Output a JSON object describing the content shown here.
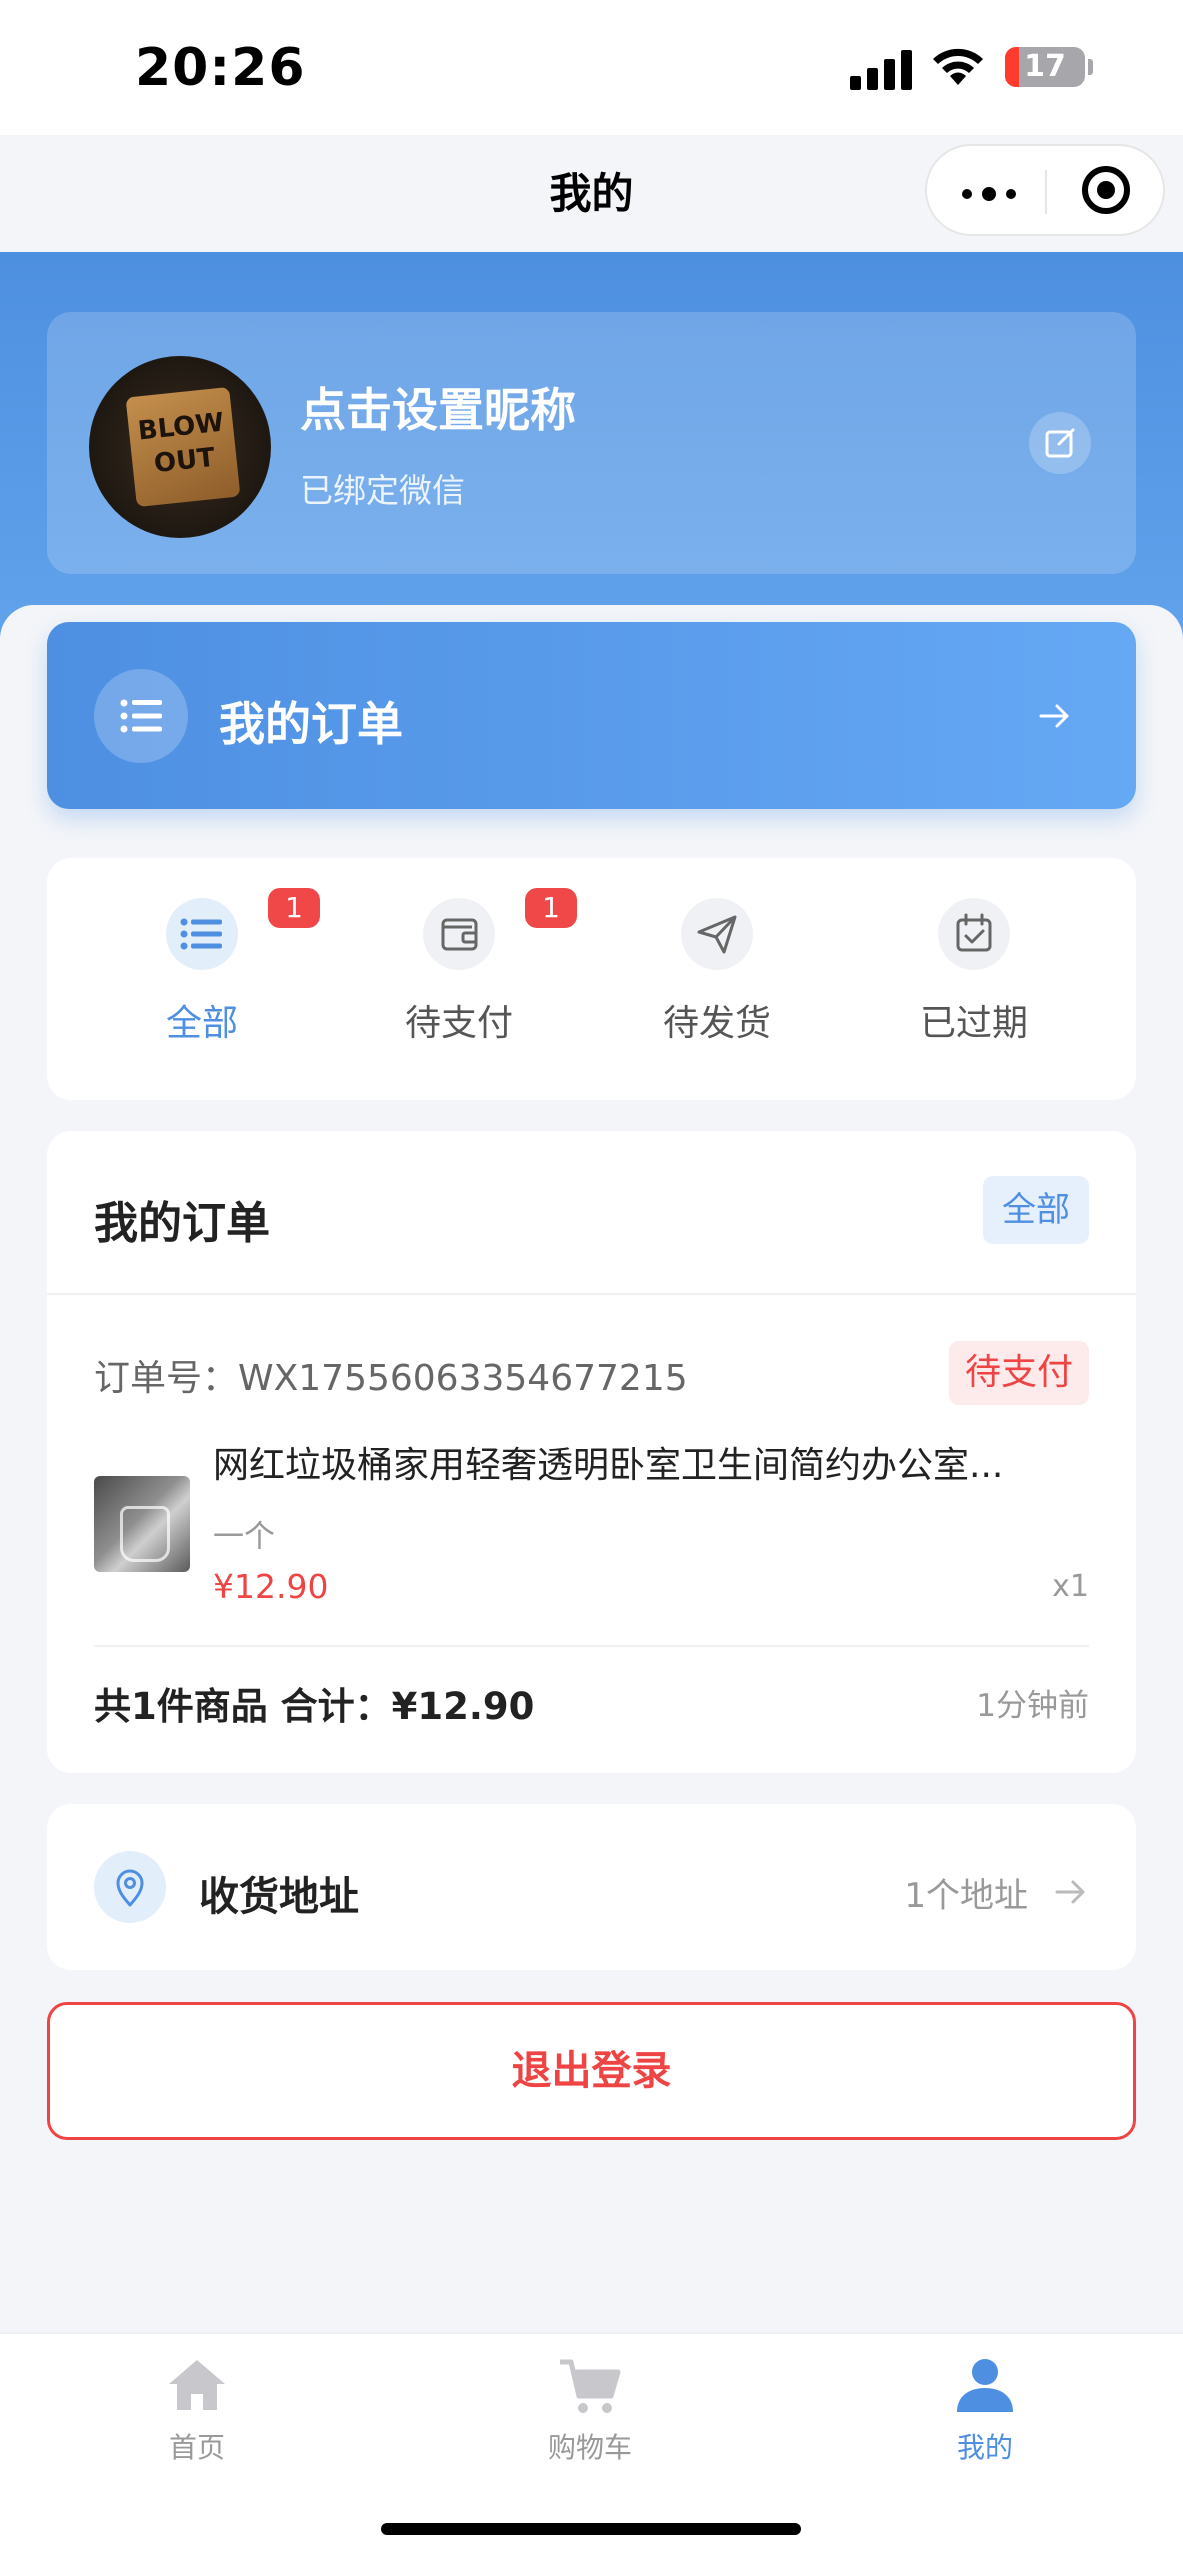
{
  "status_bar": {
    "time": "20:26",
    "battery": "17"
  },
  "nav": {
    "title": "我的"
  },
  "profile": {
    "nickname": "点击设置昵称",
    "bound_text": "已绑定微信",
    "avatar_text": [
      "BLOW",
      "OUT"
    ]
  },
  "orders_header": {
    "title": "我的订单"
  },
  "status_tabs": [
    {
      "label": "全部",
      "badge": "1",
      "icon": "list-icon",
      "active": true
    },
    {
      "label": "待支付",
      "badge": "1",
      "icon": "wallet-icon",
      "active": false
    },
    {
      "label": "待发货",
      "badge": "",
      "icon": "send-icon",
      "active": false
    },
    {
      "label": "已过期",
      "badge": "",
      "icon": "calendar-check-icon",
      "active": false
    }
  ],
  "orders_section": {
    "title": "我的订单",
    "all_label": "全部",
    "order": {
      "order_no": "订单号：WX17556063354677215",
      "status": "待支付",
      "product_name": "网红垃圾桶家用轻奢透明卧室卫生间简约办公室...",
      "spec": "一个",
      "price": "¥12.90",
      "qty": "x1",
      "summary": "共1件商品 合计：¥12.90",
      "time_ago": "1分钟前"
    }
  },
  "address": {
    "title": "收货地址",
    "count": "1个地址"
  },
  "logout": {
    "label": "退出登录"
  },
  "tabbar": [
    {
      "label": "首页",
      "icon": "home-icon",
      "active": false
    },
    {
      "label": "购物车",
      "icon": "cart-icon",
      "active": false
    },
    {
      "label": "我的",
      "icon": "user-icon",
      "active": true
    }
  ],
  "colors": {
    "primary": "#4e8fe2",
    "danger": "#ef4444",
    "background": "#f3f5f9"
  }
}
